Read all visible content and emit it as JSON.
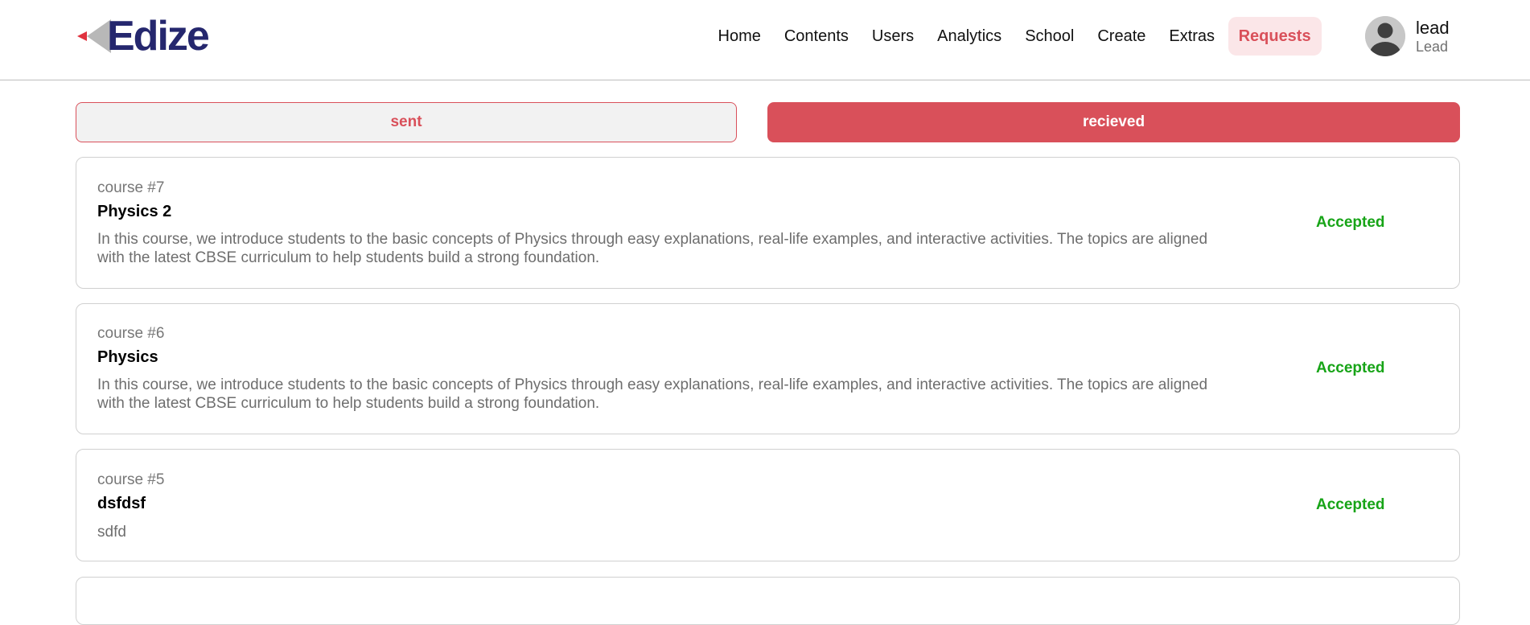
{
  "brand": {
    "name": "Edize",
    "accent": "#d9505a",
    "logo_color": "#25276e"
  },
  "nav": [
    {
      "label": "Home"
    },
    {
      "label": "Contents"
    },
    {
      "label": "Users"
    },
    {
      "label": "Analytics"
    },
    {
      "label": "School"
    },
    {
      "label": "Create"
    },
    {
      "label": "Extras"
    },
    {
      "label": "Requests",
      "active": true
    }
  ],
  "user": {
    "name": "lead",
    "role": "Lead",
    "avatar_icon": "user-avatar-icon"
  },
  "tabs": {
    "sent": "sent",
    "received": "recieved",
    "active": "received"
  },
  "requests": [
    {
      "id": "course #7",
      "title": "Physics 2",
      "description": "In this course, we introduce students to the basic concepts of Physics through easy explanations, real-life examples, and interactive activities. The topics are aligned with the latest CBSE curriculum to help students build a strong foundation.",
      "status": "Accepted"
    },
    {
      "id": "course #6",
      "title": "Physics",
      "description": "In this course, we introduce students to the basic concepts of Physics through easy explanations, real-life examples, and interactive activities. The topics are aligned with the latest CBSE curriculum to help students build a strong foundation.",
      "status": "Accepted"
    },
    {
      "id": "course #5",
      "title": "dsfdsf",
      "description": "sdfd",
      "status": "Accepted"
    }
  ],
  "status_color": "#17a417"
}
